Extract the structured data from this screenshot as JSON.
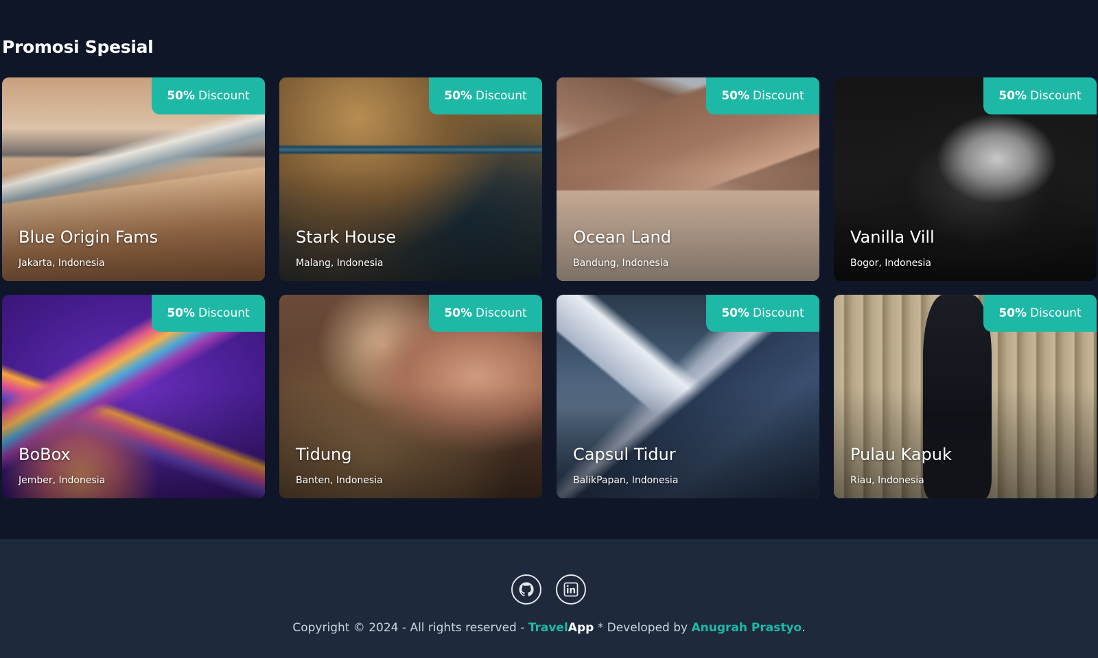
{
  "promo": {
    "title": "Promosi Spesial",
    "cards": [
      {
        "discount_value": "50%",
        "discount_label": "Discount",
        "name": "Blue Origin Fams",
        "location": "Jakarta, Indonesia"
      },
      {
        "discount_value": "50%",
        "discount_label": "Discount",
        "name": "Stark House",
        "location": "Malang, Indonesia"
      },
      {
        "discount_value": "50%",
        "discount_label": "Discount",
        "name": "Ocean Land",
        "location": "Bandung, Indonesia"
      },
      {
        "discount_value": "50%",
        "discount_label": "Discount",
        "name": "Vanilla Vill",
        "location": "Bogor, Indonesia"
      },
      {
        "discount_value": "50%",
        "discount_label": "Discount",
        "name": "BoBox",
        "location": "Jember, Indonesia"
      },
      {
        "discount_value": "50%",
        "discount_label": "Discount",
        "name": "Tidung",
        "location": "Banten, Indonesia"
      },
      {
        "discount_value": "50%",
        "discount_label": "Discount",
        "name": "Capsul Tidur",
        "location": "BalikPapan, Indonesia"
      },
      {
        "discount_value": "50%",
        "discount_label": "Discount",
        "name": "Pulau Kapuk",
        "location": "Riau, Indonesia"
      }
    ]
  },
  "footer": {
    "social_icons": [
      "github-icon",
      "linkedin-icon"
    ],
    "copyright_prefix": "Copyright © 2024 - All rights reserved - ",
    "brand_part1": "Travel",
    "brand_part2": "App",
    "developed_by": " * Developed by ",
    "developer": "Anugrah Prastyo",
    "suffix": "."
  },
  "colors": {
    "background": "#0e1628",
    "footer": "#1e293b",
    "accent": "#1db9a6"
  }
}
